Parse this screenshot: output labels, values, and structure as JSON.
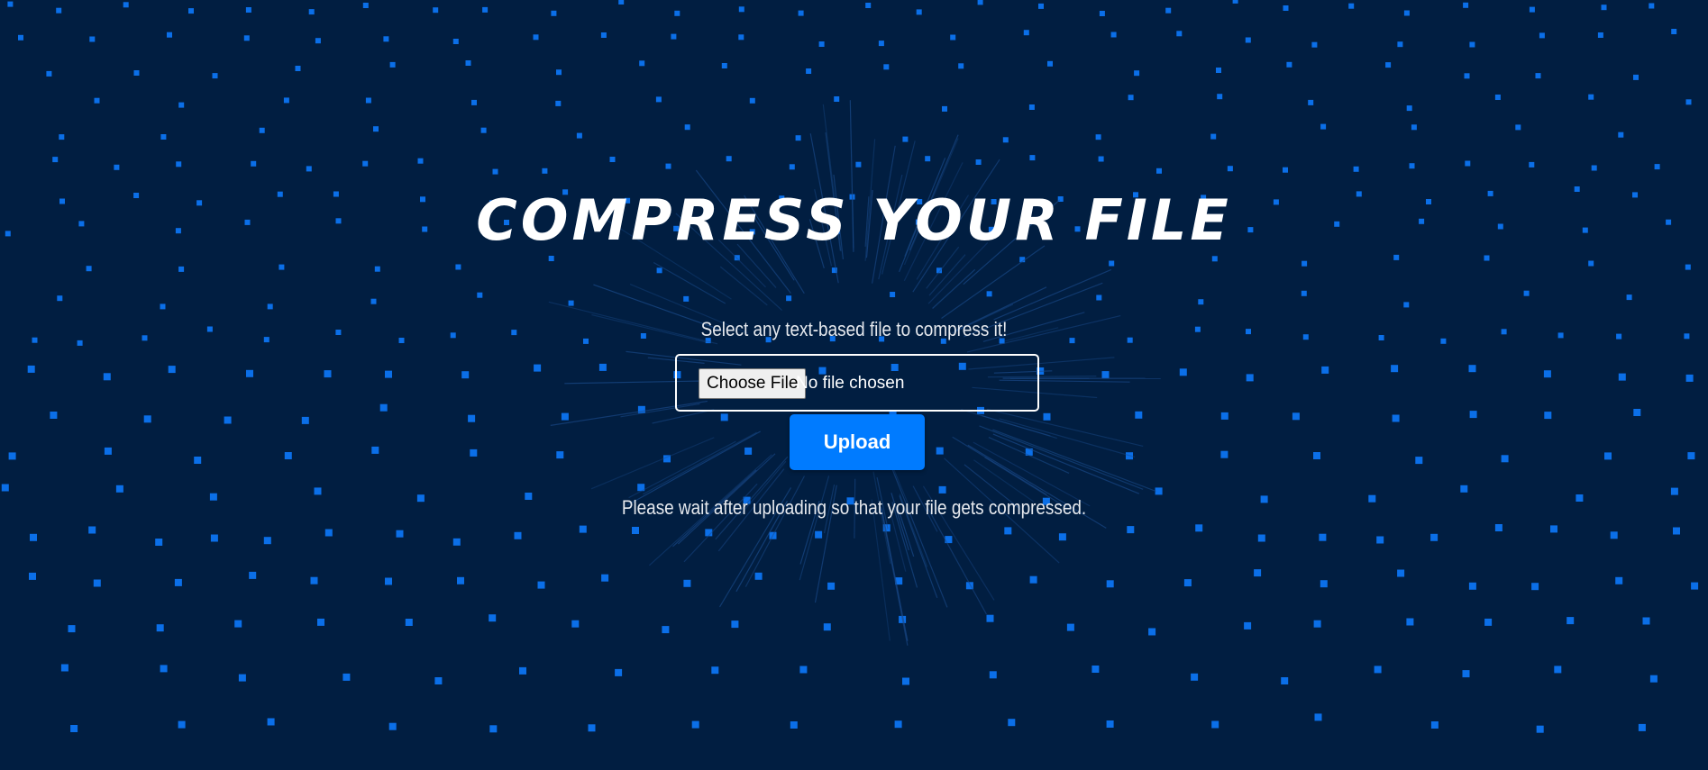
{
  "page": {
    "title": "COMPRESS YOUR FILE",
    "subtitle": "Select any text-based file to compress it!",
    "note": "Please wait after uploading so that your file gets compressed."
  },
  "form": {
    "choose_file_label": "Choose File",
    "file_status": "No file chosen",
    "upload_label": "Upload"
  },
  "colors": {
    "background": "#011e41",
    "dot": "#0b6fe8",
    "accent": "#007bff",
    "text": "#ffffff"
  },
  "background": {
    "pattern": "square-dots-icon",
    "burst": "starburst-lines"
  }
}
